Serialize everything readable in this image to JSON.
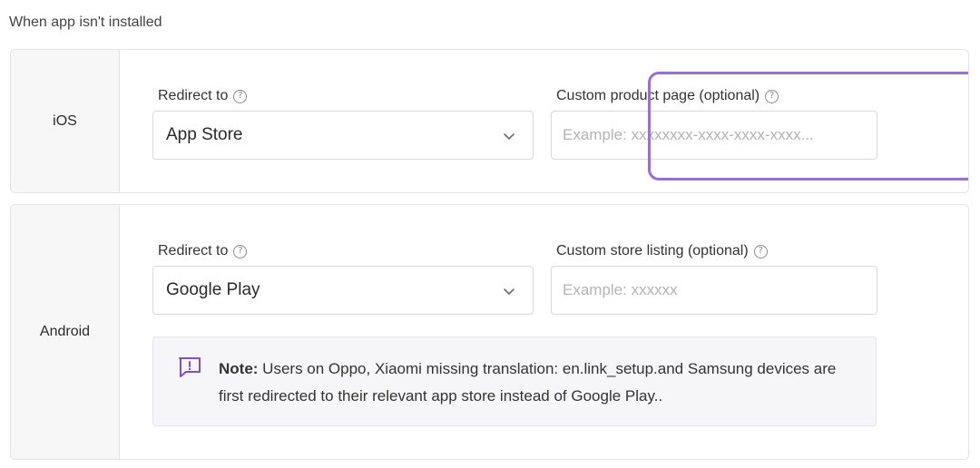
{
  "section_title": "When app isn't installed",
  "help_glyph": "?",
  "ios": {
    "platform": "iOS",
    "redirect_label": "Redirect to",
    "redirect_value": "App Store",
    "custom_label": "Custom product page (optional)",
    "custom_placeholder": "Example: xxxxxxxx-xxxx-xxxx-xxxx..."
  },
  "android": {
    "platform": "Android",
    "redirect_label": "Redirect to",
    "redirect_value": "Google Play",
    "custom_label": "Custom store listing (optional)",
    "custom_placeholder": "Example: xxxxxx",
    "note_bold": "Note:",
    "note_text": " Users on Oppo, Xiaomi missing translation: en.link_setup.and Samsung devices are first redirected to their relevant app store instead of Google Play.."
  },
  "colors": {
    "highlight": "#9b6ae6",
    "note_icon": "#7b4fd6"
  },
  "icons": {
    "help": "question-circle-icon",
    "dropdown": "chevron-down-icon",
    "note": "message-alert-icon"
  }
}
